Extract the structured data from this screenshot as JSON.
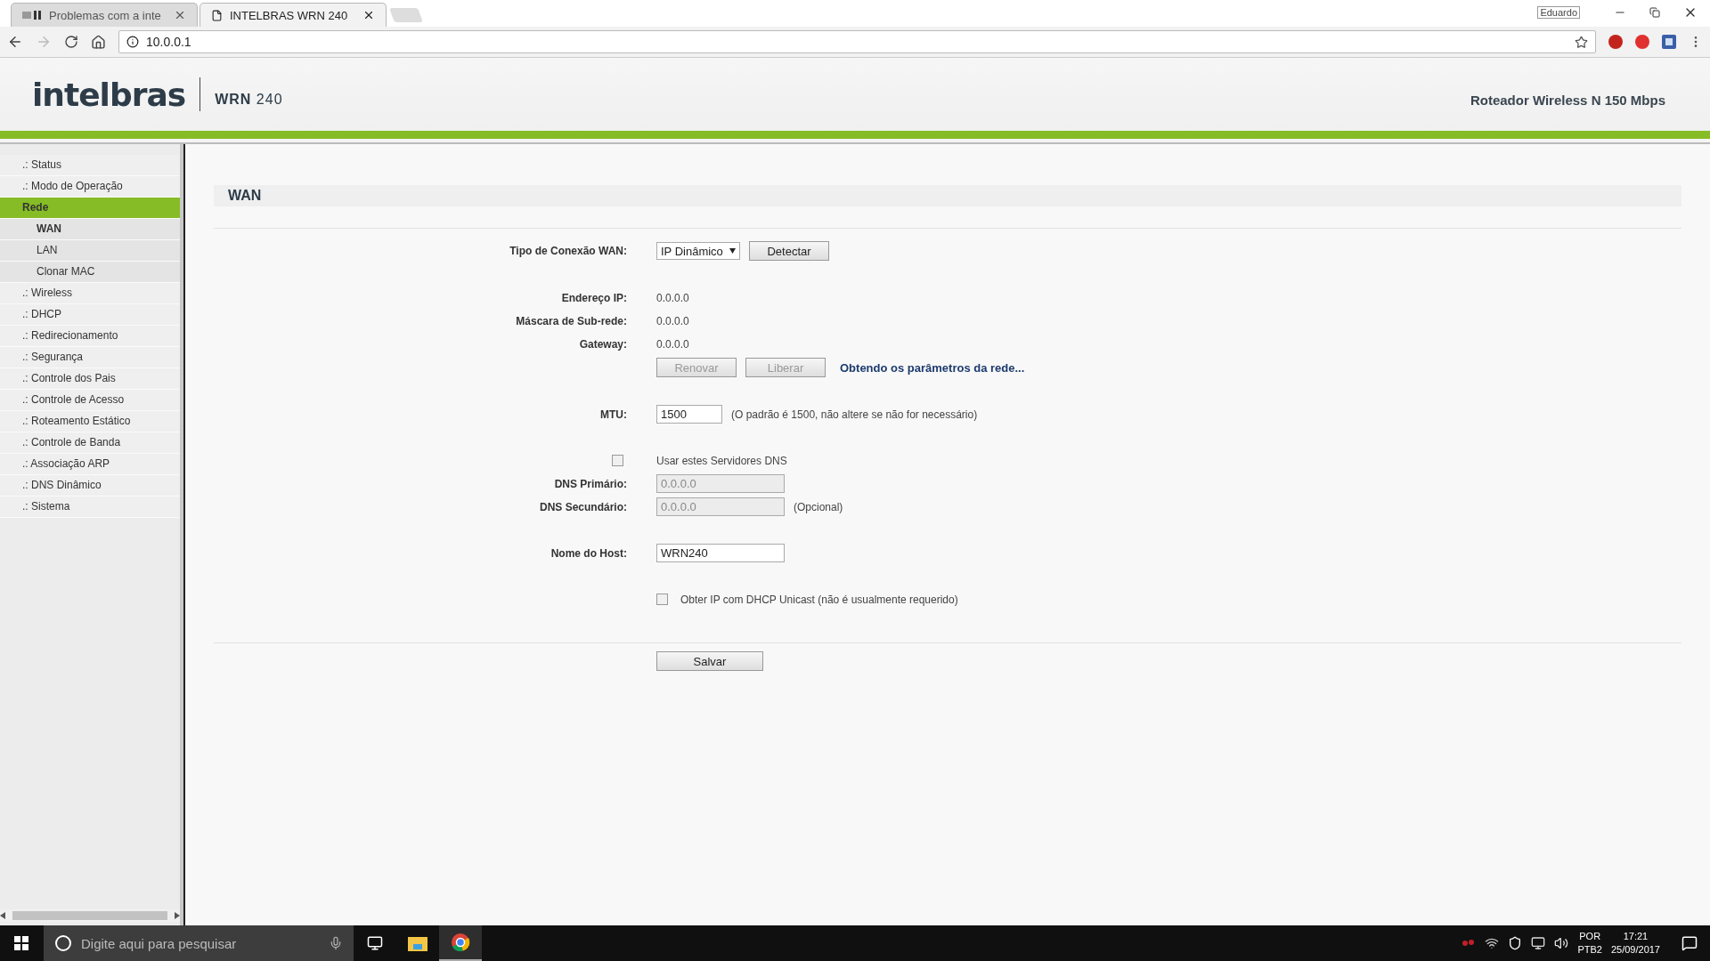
{
  "browser": {
    "tabs": [
      {
        "title": "Problemas com a inte",
        "selected": false
      },
      {
        "title": "INTELBRAS WRN 240",
        "selected": true
      }
    ],
    "profile": "Eduardo",
    "address": "10.0.0.1"
  },
  "header": {
    "logo": "intelbras",
    "model_bold": "WRN",
    "model": "240",
    "subtitle": "Roteador Wireless N 150 Mbps"
  },
  "sidebar": {
    "items": [
      {
        "label": ".: Status",
        "selected": false
      },
      {
        "label": ".: Modo de Operação",
        "selected": false
      },
      {
        "label": "Rede",
        "selected": true,
        "children": [
          {
            "label": "WAN",
            "selected": true
          },
          {
            "label": "LAN",
            "selected": false
          },
          {
            "label": "Clonar MAC",
            "selected": false
          }
        ]
      },
      {
        "label": ".: Wireless",
        "selected": false
      },
      {
        "label": ".: DHCP",
        "selected": false
      },
      {
        "label": ".: Redirecionamento",
        "selected": false
      },
      {
        "label": ".: Segurança",
        "selected": false
      },
      {
        "label": ".: Controle dos Pais",
        "selected": false
      },
      {
        "label": ".: Controle de Acesso",
        "selected": false
      },
      {
        "label": ".: Roteamento Estático",
        "selected": false
      },
      {
        "label": ".: Controle de Banda",
        "selected": false
      },
      {
        "label": ".: Associação ARP",
        "selected": false
      },
      {
        "label": ".: DNS Dinâmico",
        "selected": false
      },
      {
        "label": ".: Sistema",
        "selected": false
      }
    ]
  },
  "page": {
    "title": "WAN",
    "groups": [
      [
        {
          "kind": "select",
          "label": "Tipo de Conexão WAN:",
          "value": "IP Dinâmico",
          "button": "Detectar"
        }
      ],
      [
        {
          "kind": "info",
          "label": "Endereço IP:",
          "value": "0.0.0.0"
        },
        {
          "kind": "info",
          "label": "Máscara de Sub-rede:",
          "value": "0.0.0.0"
        },
        {
          "kind": "info",
          "label": "Gateway:",
          "value": "0.0.0.0"
        },
        {
          "kind": "actions",
          "buttons": [
            {
              "label": "Renovar",
              "disabled": true
            },
            {
              "label": "Liberar",
              "disabled": true
            }
          ],
          "status": "Obtendo os parâmetros da rede..."
        }
      ],
      [
        {
          "kind": "input",
          "label": "MTU:",
          "value": "1500",
          "disabled": false,
          "note": "(O padrão é 1500, não altere se não for necessário)"
        }
      ],
      [
        {
          "kind": "toggle",
          "text": "Usar estes Servidores DNS",
          "checked": false
        },
        {
          "kind": "input",
          "label": "DNS Primário:",
          "value": "0.0.0.0",
          "disabled": true
        },
        {
          "kind": "input",
          "label": "DNS Secundário:",
          "value": "0.0.0.0",
          "disabled": true,
          "note": "(Opcional)"
        }
      ],
      [
        {
          "kind": "input",
          "label": "Nome do Host:",
          "value": "WRN240",
          "disabled": false
        }
      ],
      [
        {
          "kind": "checkbox",
          "text": "Obter IP com DHCP Unicast (não é usualmente requerido)",
          "checked": false
        }
      ]
    ],
    "save": "Salvar"
  },
  "taskbar": {
    "search_placeholder": "Digite aqui para pesquisar",
    "language": "POR",
    "layout": "PTB2",
    "time": "17:21",
    "date": "25/09/2017"
  }
}
